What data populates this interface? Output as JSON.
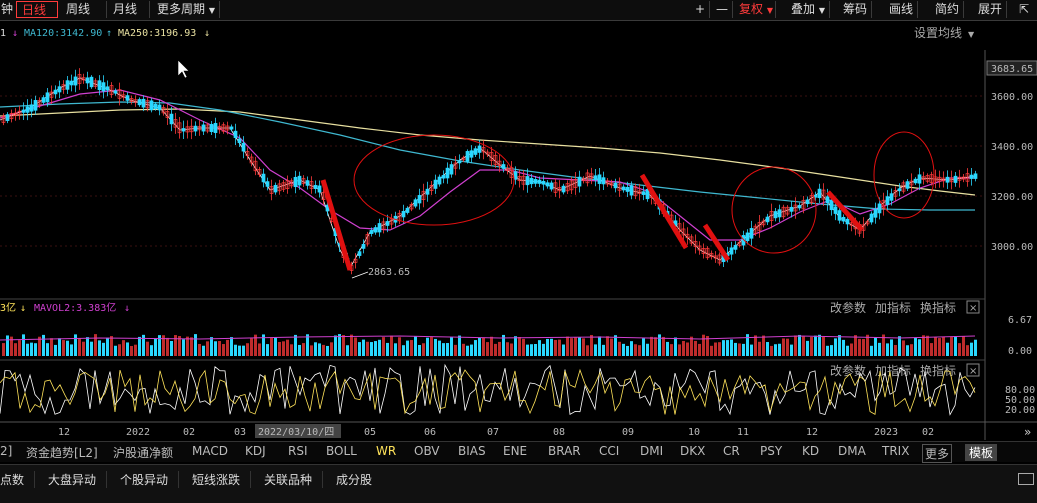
{
  "toolbar": {
    "partial_left": "钟",
    "period_tabs": [
      "日线",
      "周线",
      "月线",
      "更多周期"
    ],
    "right_buttons": [
      "+",
      "—",
      "复权",
      "叠加",
      "筹码",
      "画线",
      "简约",
      "展开"
    ],
    "expand_icon": "collapse-arrows-icon"
  },
  "ma_legend": {
    "ma1_partial": "1",
    "ma120": "MA120:3142.90",
    "ma250": "MA250:3196.93",
    "settings": "设置均线"
  },
  "price_axis": {
    "current": "3683.65",
    "ticks": [
      "3600.00",
      "3400.00",
      "3200.00",
      "3000.00"
    ]
  },
  "annotation": {
    "low_price": "2863.65"
  },
  "volume": {
    "legend_partial": "3亿",
    "mavol2": "MAVOL2:3.383亿",
    "actions": [
      "改参数",
      "加指标",
      "换指标"
    ],
    "ticks": [
      "6.67",
      "0.00"
    ]
  },
  "oscillator": {
    "actions": [
      "改参数",
      "加指标",
      "换指标"
    ],
    "ticks": [
      "80.00",
      "50.00",
      "20.00"
    ]
  },
  "time_axis": {
    "labels": [
      "12",
      "2022",
      "02",
      "03",
      "2022/03/10/四",
      "05",
      "06",
      "07",
      "08",
      "09",
      "10",
      "11",
      "12",
      "2023",
      "02"
    ]
  },
  "indicator_tabs": [
    "2]",
    "资金趋势[L2]",
    "沪股通净额",
    "MACD",
    "KDJ",
    "RSI",
    "BOLL",
    "WR",
    "OBV",
    "BIAS",
    "ENE",
    "BRAR",
    "CCI",
    "DMI",
    "DKX",
    "CR",
    "PSY",
    "KD",
    "DMA",
    "TRIX",
    "更多",
    "模板"
  ],
  "selected_indicator": "WR",
  "bottom_tabs": [
    "点数",
    "大盘异动",
    "个股异动",
    "短线涨跌",
    "关联品种",
    "成分股"
  ],
  "colors": {
    "up": "#ff3b3b",
    "down": "#2ad8ff",
    "ma_white": "#ffffff",
    "ma_purple": "#d040d0",
    "ma_cyan": "#3fb8d0",
    "ma_yellow": "#e8e0a0",
    "annotation_red": "#e01010"
  }
}
